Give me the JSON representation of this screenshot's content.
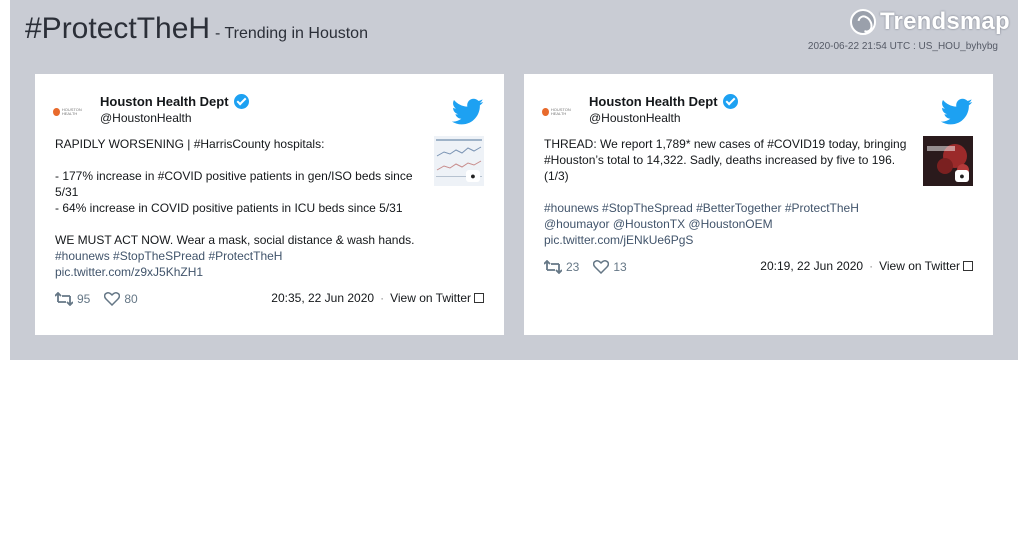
{
  "header": {
    "hashtag": "#ProtectTheH",
    "subtitle": "- Trending in Houston",
    "logo_text": "Trendsmap",
    "meta": "2020-06-22 21:54 UTC : US_HOU_byhybg"
  },
  "tweets": [
    {
      "name": "Houston Health Dept",
      "handle": "@HoustonHealth",
      "lines": [
        "RAPIDLY WORSENING | #HarrisCounty hospitals:",
        "",
        "- 177% increase in #COVID positive patients in gen/ISO beds since",
        "5/31",
        "- 64% increase in COVID positive patients in ICU beds since 5/31",
        "",
        "WE MUST ACT NOW. Wear a mask, social distance & wash hands.",
        "#hounews #StopTheSPread #ProtectTheH",
        "pic.twitter.com/z9xJ5KhZH1"
      ],
      "retweets": "95",
      "likes": "80",
      "timestamp": "20:35, 22 Jun 2020",
      "view_label": "View on Twitter"
    },
    {
      "name": "Houston Health Dept",
      "handle": "@HoustonHealth",
      "lines": [
        "THREAD: We report 1,789* new cases of #COVID19 today, bringing",
        "#Houston’s total to 14,322. Sadly, deaths increased by five to 196.",
        "(1/3)",
        "",
        "#hounews #StopTheSpread #BetterTogether #ProtectTheH",
        "@houmayor @HoustonTX @HoustonOEM",
        "pic.twitter.com/jENkUe6PgS"
      ],
      "retweets": "23",
      "likes": "13",
      "timestamp": "20:19, 22 Jun 2020",
      "view_label": "View on Twitter"
    }
  ],
  "colors": {
    "panel_bg": "#c9ccd4",
    "twitter_blue": "#1da1f2",
    "hashtag_color": "#41546b"
  },
  "icons": [
    "verified-icon",
    "twitter-bird-icon",
    "retweet-icon",
    "like-icon",
    "camera-icon",
    "external-link-icon"
  ]
}
